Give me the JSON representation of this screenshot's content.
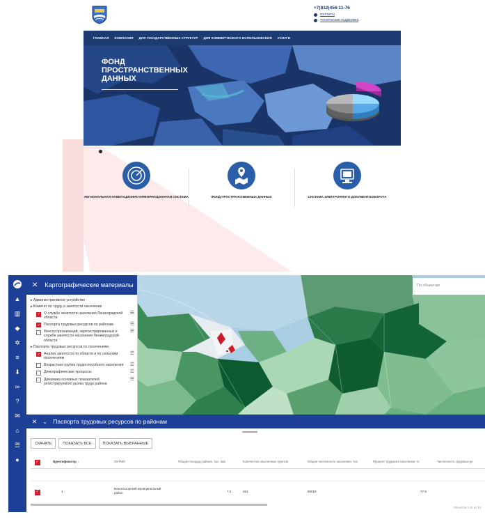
{
  "site": {
    "phone": "+7(812)456-11-76",
    "contacts_link": "контакты",
    "support_link": "техническая поддержка",
    "nav": [
      "ГЛАВНАЯ",
      "КОМПАНИЯ",
      "ДЛЯ ГОСУДАРСТВЕННЫХ СТРУКТУР",
      "ДЛЯ КОММЕРЧЕСКОГО ИСПОЛЬЗОВАНИЯ",
      "УСЛУГИ"
    ],
    "hero_line1": "ФОНД",
    "hero_line2": "ПРОСТРАНСТВЕННЫХ",
    "hero_line3": "ДАННЫХ",
    "services": [
      {
        "label": "РЕГИОНАЛЬНАЯ НАВИГАЦИОННО-ИНФОРМАЦИОННАЯ СИСТЕМА",
        "icon": "radar-icon"
      },
      {
        "label": "ФОНД ПРОСТРАНСТВЕННЫХ ДАННЫХ",
        "icon": "map-pin-icon"
      },
      {
        "label": "СИСТЕМА ЭЛЕКТРОННОГО ДОКУМЕНТООБОРОТА",
        "icon": "monitor-icon"
      }
    ],
    "colors": {
      "brand": "#1e3c72",
      "accent": "#2b5ea8"
    }
  },
  "app": {
    "layers_title": "Картографические материалы",
    "search_placeholder": "По объектам",
    "tree": {
      "g1": "Административное устройство",
      "g2": "Комитет по труду и занятости населения",
      "g2_items": [
        {
          "label": "О службе занятости населения Ленинградской области",
          "checked": true
        },
        {
          "label": "Паспорта трудовых ресурсов по районам",
          "checked": true
        },
        {
          "label": "Реестр организаций, зарегистрированных в службе занятости населения Ленинградской области",
          "checked": false
        }
      ],
      "g3": "Паспорта трудовых ресурсов по поселениям",
      "g3_items": [
        {
          "label": "Анализ занятости по области и по сельским поселениям",
          "checked": true
        },
        {
          "label": "Возрастная группа трудоспособного населения",
          "checked": false
        },
        {
          "label": "Демографические процессы",
          "checked": false
        },
        {
          "label": "Динамика основных показателей регистрируемого рынка труда района",
          "checked": false
        }
      ]
    },
    "table_title": "Паспорта трудовых ресурсов по районам",
    "buttons": {
      "download": "СКАЧАТЬ",
      "show_all": "ПОКАЗАТЬ ВСЕ",
      "show_selected": "ПОКАЗАТЬ ВЫБРАННЫЕ"
    },
    "columns": [
      "Идентификатор ↓",
      "OKTMO",
      "Общая площадь района, тыс. км2",
      "Количество населенных пунктов",
      "Общая численность населения, чел",
      "Процент трудового населения, %",
      "Численность трудовых ре"
    ],
    "rows": [
      {
        "id": "1",
        "name": "Бокситогорский муниципальный район",
        "area": "7.2",
        "settlements": "261",
        "population": "50019",
        "percent": "77.9"
      }
    ],
    "pagination": "Объектов 1-15 из 15",
    "colors": {
      "rail": "#1e3f96",
      "checkbox": "#cc1f2f"
    }
  }
}
